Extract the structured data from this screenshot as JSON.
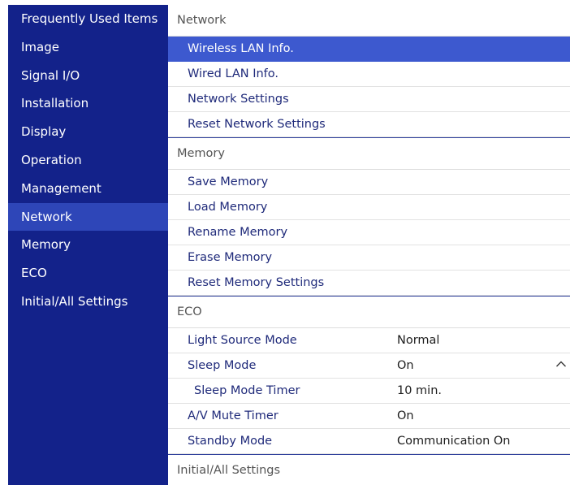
{
  "sidebar": {
    "items": [
      {
        "label": "Frequently Used Items"
      },
      {
        "label": "Image"
      },
      {
        "label": "Signal I/O"
      },
      {
        "label": "Installation"
      },
      {
        "label": "Display"
      },
      {
        "label": "Operation"
      },
      {
        "label": "Management"
      },
      {
        "label": "Network"
      },
      {
        "label": "Memory"
      },
      {
        "label": "ECO"
      },
      {
        "label": "Initial/All Settings"
      }
    ],
    "active": "Network"
  },
  "network": {
    "header": "Network",
    "items": [
      {
        "label": "Wireless LAN Info."
      },
      {
        "label": "Wired LAN Info."
      },
      {
        "label": "Network Settings"
      },
      {
        "label": "Reset Network Settings"
      }
    ]
  },
  "memory": {
    "header": "Memory",
    "items": [
      {
        "label": "Save Memory"
      },
      {
        "label": "Load Memory"
      },
      {
        "label": "Rename Memory"
      },
      {
        "label": "Erase Memory"
      },
      {
        "label": "Reset Memory Settings"
      }
    ]
  },
  "eco": {
    "header": "ECO",
    "items": [
      {
        "label": "Light Source Mode",
        "value": "Normal"
      },
      {
        "label": "Sleep Mode",
        "value": "On"
      },
      {
        "label": "Sleep Mode Timer",
        "value": "10 min."
      },
      {
        "label": "A/V Mute Timer",
        "value": "On"
      },
      {
        "label": "Standby Mode",
        "value": "Communication On"
      }
    ]
  },
  "initial": {
    "header": "Initial/All Settings"
  },
  "icons": {
    "sleep_mode_caret": "chevron-up-icon"
  },
  "colors": {
    "sidebar_bg": "#13228a",
    "sidebar_active": "#2e46b8",
    "selected_row": "#3d59cf",
    "item_text": "#1f2a7a"
  }
}
